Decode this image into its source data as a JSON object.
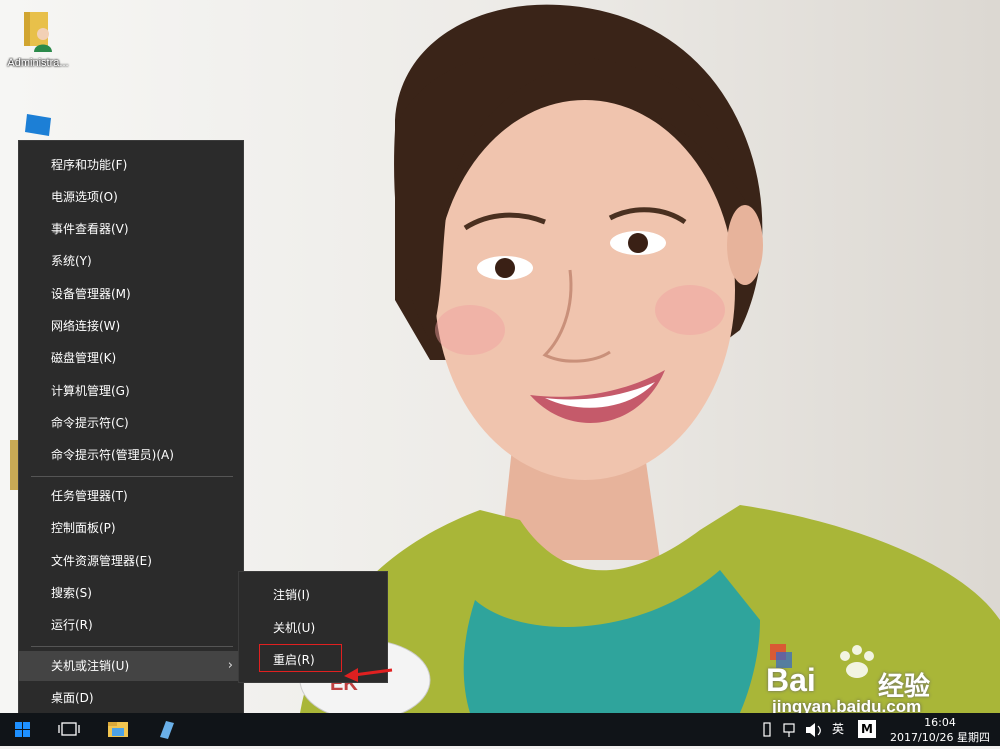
{
  "desktop": {
    "icons": [
      {
        "label": "Administra...",
        "icon": "user-folder-icon"
      },
      {
        "label": "",
        "icon": "this-pc-icon"
      }
    ]
  },
  "menu": {
    "items_group1": [
      "程序和功能(F)",
      "电源选项(O)",
      "事件查看器(V)",
      "系统(Y)",
      "设备管理器(M)",
      "网络连接(W)",
      "磁盘管理(K)",
      "计算机管理(G)",
      "命令提示符(C)",
      "命令提示符(管理员)(A)"
    ],
    "items_group2": [
      "任务管理器(T)",
      "控制面板(P)",
      "文件资源管理器(E)",
      "搜索(S)",
      "运行(R)"
    ],
    "shutdown_item": "关机或注销(U)",
    "desktop_item": "桌面(D)",
    "chevron": "›"
  },
  "submenu": {
    "items": [
      "注销(I)",
      "关机(U)",
      "重启(R)"
    ]
  },
  "watermark": {
    "brand": "Bai",
    "brand2": "经验",
    "url": "jingyan.baidu.com"
  },
  "taskbar": {
    "language": "英",
    "ime": "M",
    "time": "16:04",
    "date": "2017/10/26 星期四"
  },
  "colors": {
    "menu_bg": "#2b2b2b",
    "taskbar_bg": "#101418",
    "highlight_border": "#e02020",
    "start_blue": "#1e90ff"
  }
}
